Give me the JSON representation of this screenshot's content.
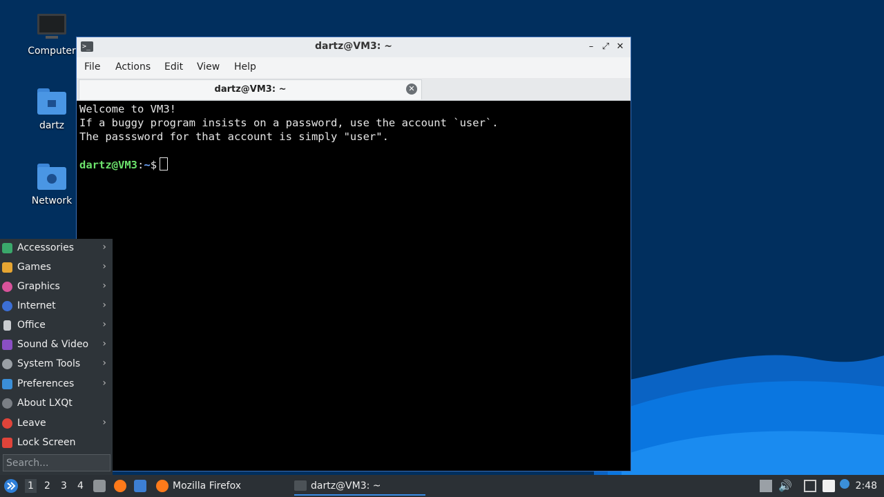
{
  "desktop": {
    "icons": [
      {
        "label": "Computer"
      },
      {
        "label": "dartz"
      },
      {
        "label": "Network"
      }
    ]
  },
  "window": {
    "title": "dartz@VM3: ~",
    "menu": [
      "File",
      "Actions",
      "Edit",
      "View",
      "Help"
    ],
    "tab_label": "dartz@VM3: ~",
    "terminal": {
      "lines": [
        "Welcome to VM3!",
        "If a buggy program insists on a password, use the account `user`.",
        "The passsword for that account is simply \"user\"."
      ],
      "prompt_user": "dartz@VM3",
      "prompt_sep": ":",
      "prompt_path": "~",
      "prompt_symbol": "$"
    }
  },
  "app_menu": {
    "items": [
      {
        "label": "Accessories",
        "icon": "accessories-icon",
        "color": "#3aa86b"
      },
      {
        "label": "Games",
        "icon": "games-icon",
        "color": "#e6a532"
      },
      {
        "label": "Graphics",
        "icon": "graphics-icon",
        "color": "#d8539b"
      },
      {
        "label": "Internet",
        "icon": "internet-icon",
        "color": "#3c6fd6"
      },
      {
        "label": "Office",
        "icon": "office-icon",
        "color": "#c9ccd0"
      },
      {
        "label": "Sound & Video",
        "icon": "sound-video-icon",
        "color": "#8a4fc4"
      },
      {
        "label": "System Tools",
        "icon": "system-tools-icon",
        "color": "#9aa0a6"
      },
      {
        "label": "Preferences",
        "icon": "preferences-icon",
        "color": "#3b8fd8"
      },
      {
        "label": "About LXQt",
        "icon": "info-icon",
        "color": "#7a7f85"
      },
      {
        "label": "Leave",
        "icon": "power-icon",
        "color": "#e0443a"
      },
      {
        "label": "Lock Screen",
        "icon": "lock-icon",
        "color": "#e0443a"
      }
    ],
    "search_placeholder": "Search..."
  },
  "taskbar": {
    "workspaces": [
      "1",
      "2",
      "3",
      "4"
    ],
    "tasks": [
      {
        "label": "Mozilla Firefox"
      },
      {
        "label": "dartz@VM3: ~"
      }
    ],
    "clock": "2:48"
  }
}
